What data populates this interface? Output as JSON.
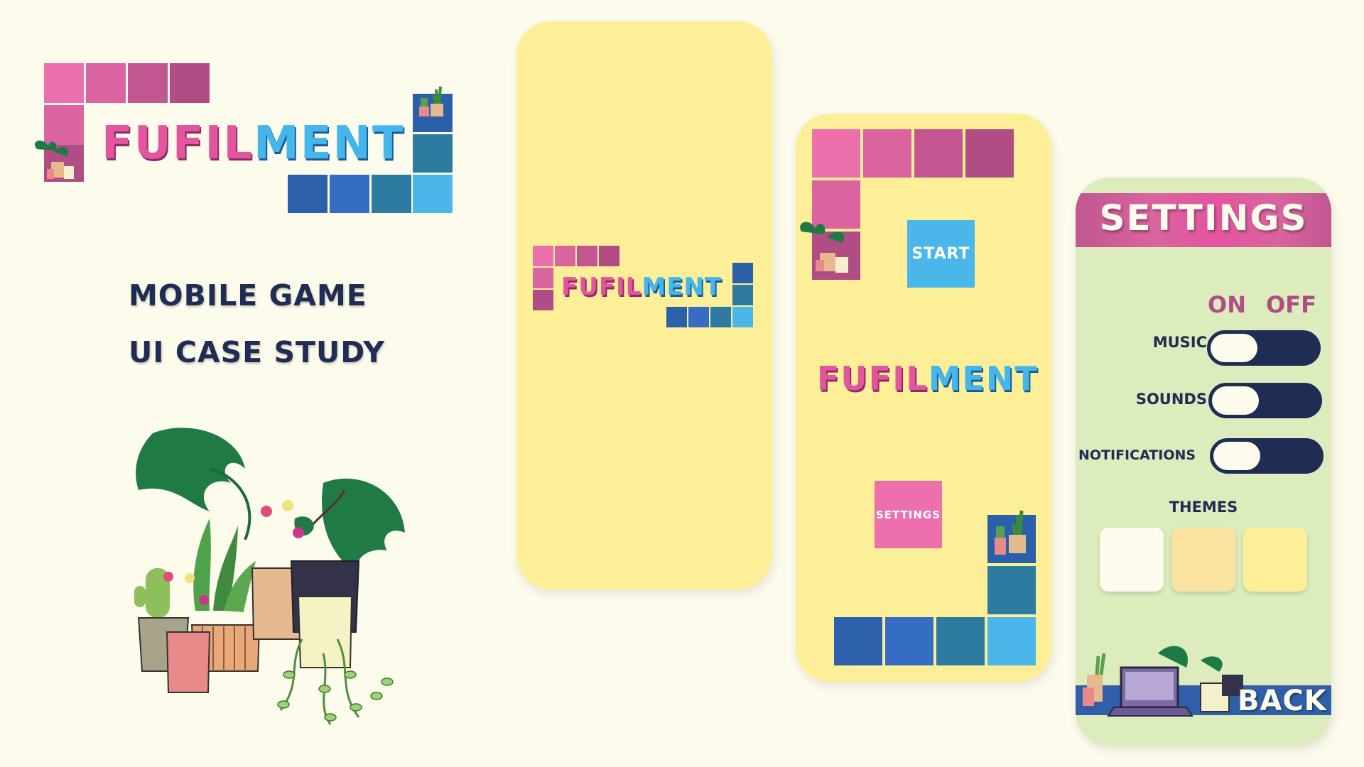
{
  "logo": {
    "word_pink": "FUFIL",
    "word_blue": "MENT"
  },
  "left_panel": {
    "line1": "MOBILE GAME",
    "line2": "UI CASE STUDY"
  },
  "splash_screen": {
    "word_pink": "FUFIL",
    "word_blue": "MENT"
  },
  "menu_screen": {
    "start_label": "START",
    "settings_label": "SETTINGS",
    "title_pink": "FUFIL",
    "title_blue": "MENT"
  },
  "settings_screen": {
    "title": "SETTINGS",
    "on_label": "ON",
    "off_label": "OFF",
    "rows": [
      {
        "label": "MUSIC",
        "state": "on"
      },
      {
        "label": "SOUNDS",
        "state": "on"
      },
      {
        "label": "NOTIFICATIONS",
        "state": "on"
      }
    ],
    "themes_label": "THEMES",
    "themes": [
      "#fdfcec",
      "#f9e3a1",
      "#fdef98"
    ],
    "back_label": "BACK"
  },
  "colors": {
    "background": "#fdfcec",
    "phone_yellow": "#fdef98",
    "settings_green": "#dcecbd",
    "navy": "#1f2c54",
    "pink": "#e4559f",
    "blue": "#45b6ec"
  },
  "icons": [
    "house-plants-illustration-icon",
    "potted-plant-icon",
    "laptop-desk-icon"
  ]
}
